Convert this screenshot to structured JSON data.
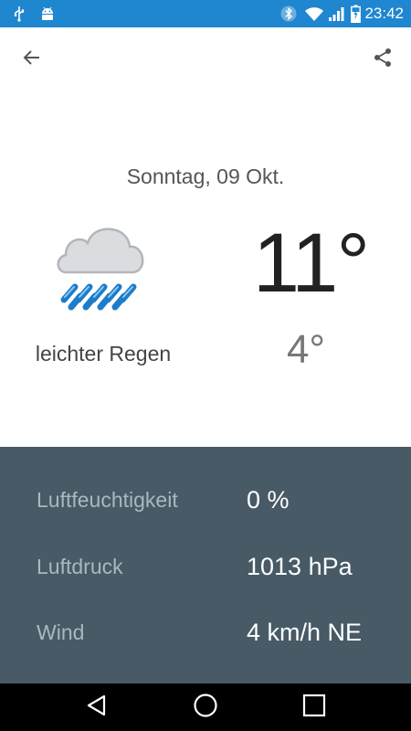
{
  "status_bar": {
    "time": "23:42",
    "icons": [
      "usb-icon",
      "android-icon",
      "bluetooth-icon",
      "wifi-icon",
      "signal-icon",
      "battery-charging-icon"
    ]
  },
  "toolbar": {
    "back_icon": "arrow-left-icon",
    "share_icon": "share-icon"
  },
  "weather": {
    "date": "Sonntag, 09 Okt.",
    "condition": "leichter Regen",
    "temp_high": "11°",
    "temp_low": "4°",
    "icon": "light-rain-icon"
  },
  "details": [
    {
      "label": "Luftfeuchtigkeit",
      "value": "0 %"
    },
    {
      "label": "Luftdruck",
      "value": "1013 hPa"
    },
    {
      "label": "Wind",
      "value": "4 km/h NE"
    }
  ],
  "nav_bar": {
    "icons": [
      "back-triangle-icon",
      "home-circle-icon",
      "recents-square-icon"
    ]
  },
  "colors": {
    "status_bar": "#1f86d0",
    "details_panel": "#475a66",
    "detail_label": "#a9b8c2",
    "rain_blue": "#1e88e5"
  }
}
